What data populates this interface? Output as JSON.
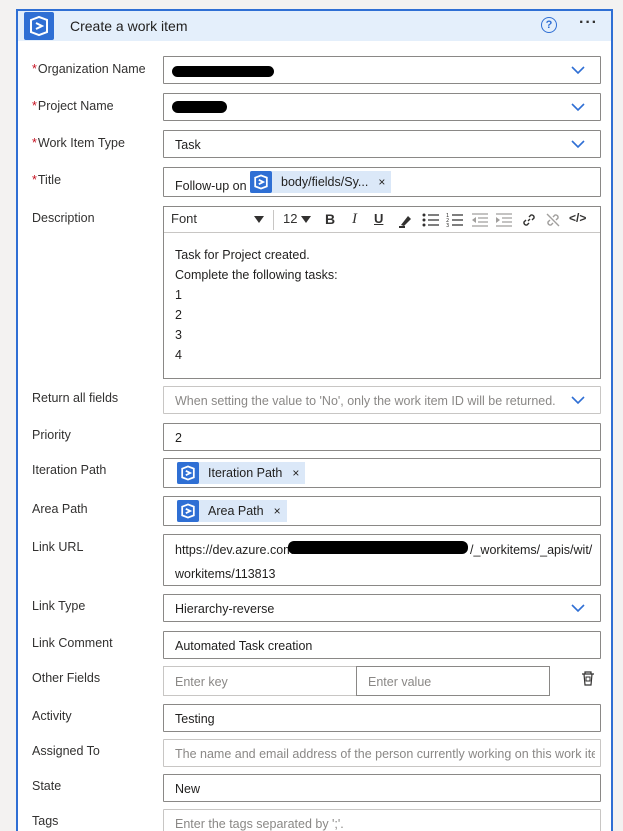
{
  "header": {
    "title": "Create a work item",
    "help_label": "?",
    "more_label": "···"
  },
  "fields": {
    "organization": {
      "label": "Organization Name",
      "required_mark": "*"
    },
    "project": {
      "label": "Project Name",
      "required_mark": "*"
    },
    "work_item_type": {
      "label": "Work Item Type",
      "required_mark": "*",
      "value": "Task"
    },
    "title": {
      "label": "Title",
      "required_mark": "*",
      "prefix": "Follow-up on",
      "token": "body/fields/Sy...",
      "token_remove": "×"
    },
    "description": {
      "label": "Description",
      "font": "Font",
      "size": "12",
      "toolbar": {
        "bold": "B",
        "italic": "I",
        "underline": "U",
        "code": "</>"
      },
      "lines": [
        "Task for Project created.",
        "Complete the following tasks:",
        "1",
        "2",
        "3",
        "4"
      ]
    },
    "return_all_fields": {
      "label": "Return all fields",
      "placeholder": "When setting the value to 'No', only the work item ID will be returned. If"
    },
    "priority": {
      "label": "Priority",
      "value": "2"
    },
    "iteration_path": {
      "label": "Iteration Path",
      "token": "Iteration Path",
      "token_remove": "×"
    },
    "area_path": {
      "label": "Area Path",
      "token": "Area Path",
      "token_remove": "×"
    },
    "link_url": {
      "label": "Link URL",
      "line1_start": "https://dev.azure.com",
      "line1_end": "/_workitems/_apis/wit/",
      "line2": "workitems/113813"
    },
    "link_type": {
      "label": "Link Type",
      "value": "Hierarchy-reverse"
    },
    "link_comment": {
      "label": "Link Comment",
      "value": "Automated Task creation"
    },
    "other_fields": {
      "label": "Other Fields",
      "key_placeholder": "Enter key",
      "value_placeholder": "Enter value"
    },
    "activity": {
      "label": "Activity",
      "value": "Testing"
    },
    "assigned_to": {
      "label": "Assigned To",
      "placeholder": "The name and email address of the person currently working on this work item"
    },
    "state": {
      "label": "State",
      "value": "New"
    },
    "tags": {
      "label": "Tags",
      "placeholder": "Enter the tags separated by ';'."
    }
  },
  "colors": {
    "accent": "#2f6fd4",
    "header_bg": "#e4effb",
    "required": "#c50f1f",
    "token_bg": "#dbe8f8"
  },
  "icons": [
    "azure-devops-icon",
    "help-icon",
    "more-icon",
    "chevron-down-icon",
    "delete-icon"
  ]
}
